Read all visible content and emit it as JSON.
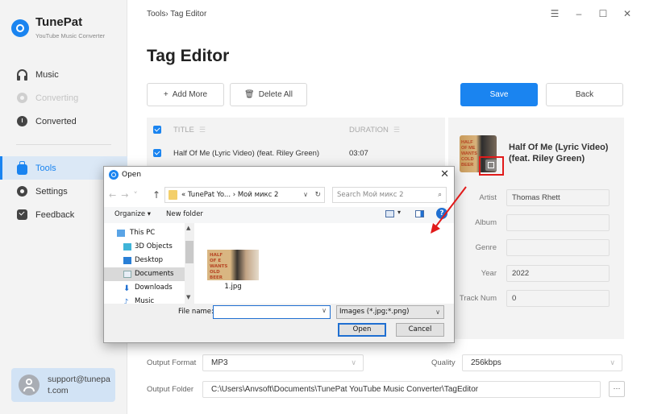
{
  "app": {
    "name": "TunePat",
    "subtitle": "YouTube Music Converter"
  },
  "sidebar": {
    "items": [
      {
        "label": "Music",
        "icon": "headphones-icon",
        "state": "normal"
      },
      {
        "label": "Converting",
        "icon": "converting-icon",
        "state": "disabled"
      },
      {
        "label": "Converted",
        "icon": "clock-icon",
        "state": "normal"
      },
      {
        "label": "Tools",
        "icon": "toolbox-icon",
        "state": "active"
      },
      {
        "label": "Settings",
        "icon": "gear-icon",
        "state": "normal"
      },
      {
        "label": "Feedback",
        "icon": "mail-icon",
        "state": "normal"
      }
    ],
    "support_email": "support@tunepat.com"
  },
  "header": {
    "breadcrumb": "Tools›  Tag Editor",
    "window_controls": [
      "menu",
      "minimize",
      "maximize",
      "close"
    ],
    "page_title": "Tag Editor"
  },
  "toolbar": {
    "add_more": "Add More",
    "delete_all": "Delete All",
    "save": "Save",
    "back": "Back"
  },
  "track_list": {
    "columns": [
      "TITLE",
      "DURATION"
    ],
    "rows": [
      {
        "title": "Half Of Me (Lyric Video) (feat. Riley Green)",
        "duration": "03:07",
        "checked": true
      }
    ],
    "select_all_checked": true
  },
  "details": {
    "title": "Half Of Me (Lyric Video) (feat. Riley Green)",
    "cover_text": "HALF OF ME WANTS COLD BEER",
    "fields": [
      {
        "label": "Artist",
        "value": "Thomas Rhett"
      },
      {
        "label": "Album",
        "value": ""
      },
      {
        "label": "Genre",
        "value": ""
      },
      {
        "label": "Year",
        "value": "2022"
      },
      {
        "label": "Track Num",
        "value": "0"
      }
    ]
  },
  "output": {
    "format_label": "Output Format",
    "format_value": "MP3",
    "quality_label": "Quality",
    "quality_value": "256kbps",
    "folder_label": "Output Folder",
    "folder_value": "C:\\Users\\Anvsoft\\Documents\\TunePat YouTube Music Converter\\TagEditor",
    "browse_label": "···"
  },
  "dialog": {
    "title": "Open",
    "close": "✕",
    "address_path": "«  TunePat Yo...  ›  Мой микс 2",
    "search_placeholder": "Search Мой микс 2",
    "organize": "Organize ▾",
    "new_folder": "New folder",
    "help": "?",
    "tree": [
      {
        "label": "This PC",
        "icon": "computer-icon",
        "selected": false
      },
      {
        "label": "3D Objects",
        "icon": "cube-icon",
        "selected": false
      },
      {
        "label": "Desktop",
        "icon": "desktop-icon",
        "selected": false
      },
      {
        "label": "Documents",
        "icon": "document-icon",
        "selected": true
      },
      {
        "label": "Downloads",
        "icon": "download-icon",
        "selected": false
      },
      {
        "label": "Music",
        "icon": "music-icon",
        "selected": false
      }
    ],
    "files": [
      {
        "name": "1.jpg",
        "thumb_text": "HALF OF E WANTS OLD BEER"
      }
    ],
    "file_name_label": "File name:",
    "file_name_value": "",
    "file_type": "Images (*.jpg;*.png)",
    "open_button": "Open",
    "cancel_button": "Cancel"
  },
  "colors": {
    "accent": "#1a84f0",
    "highlight": "#e11a1a",
    "sidebar_bg": "#f3f3f3",
    "active_nav_bg": "#dbe8f6"
  }
}
